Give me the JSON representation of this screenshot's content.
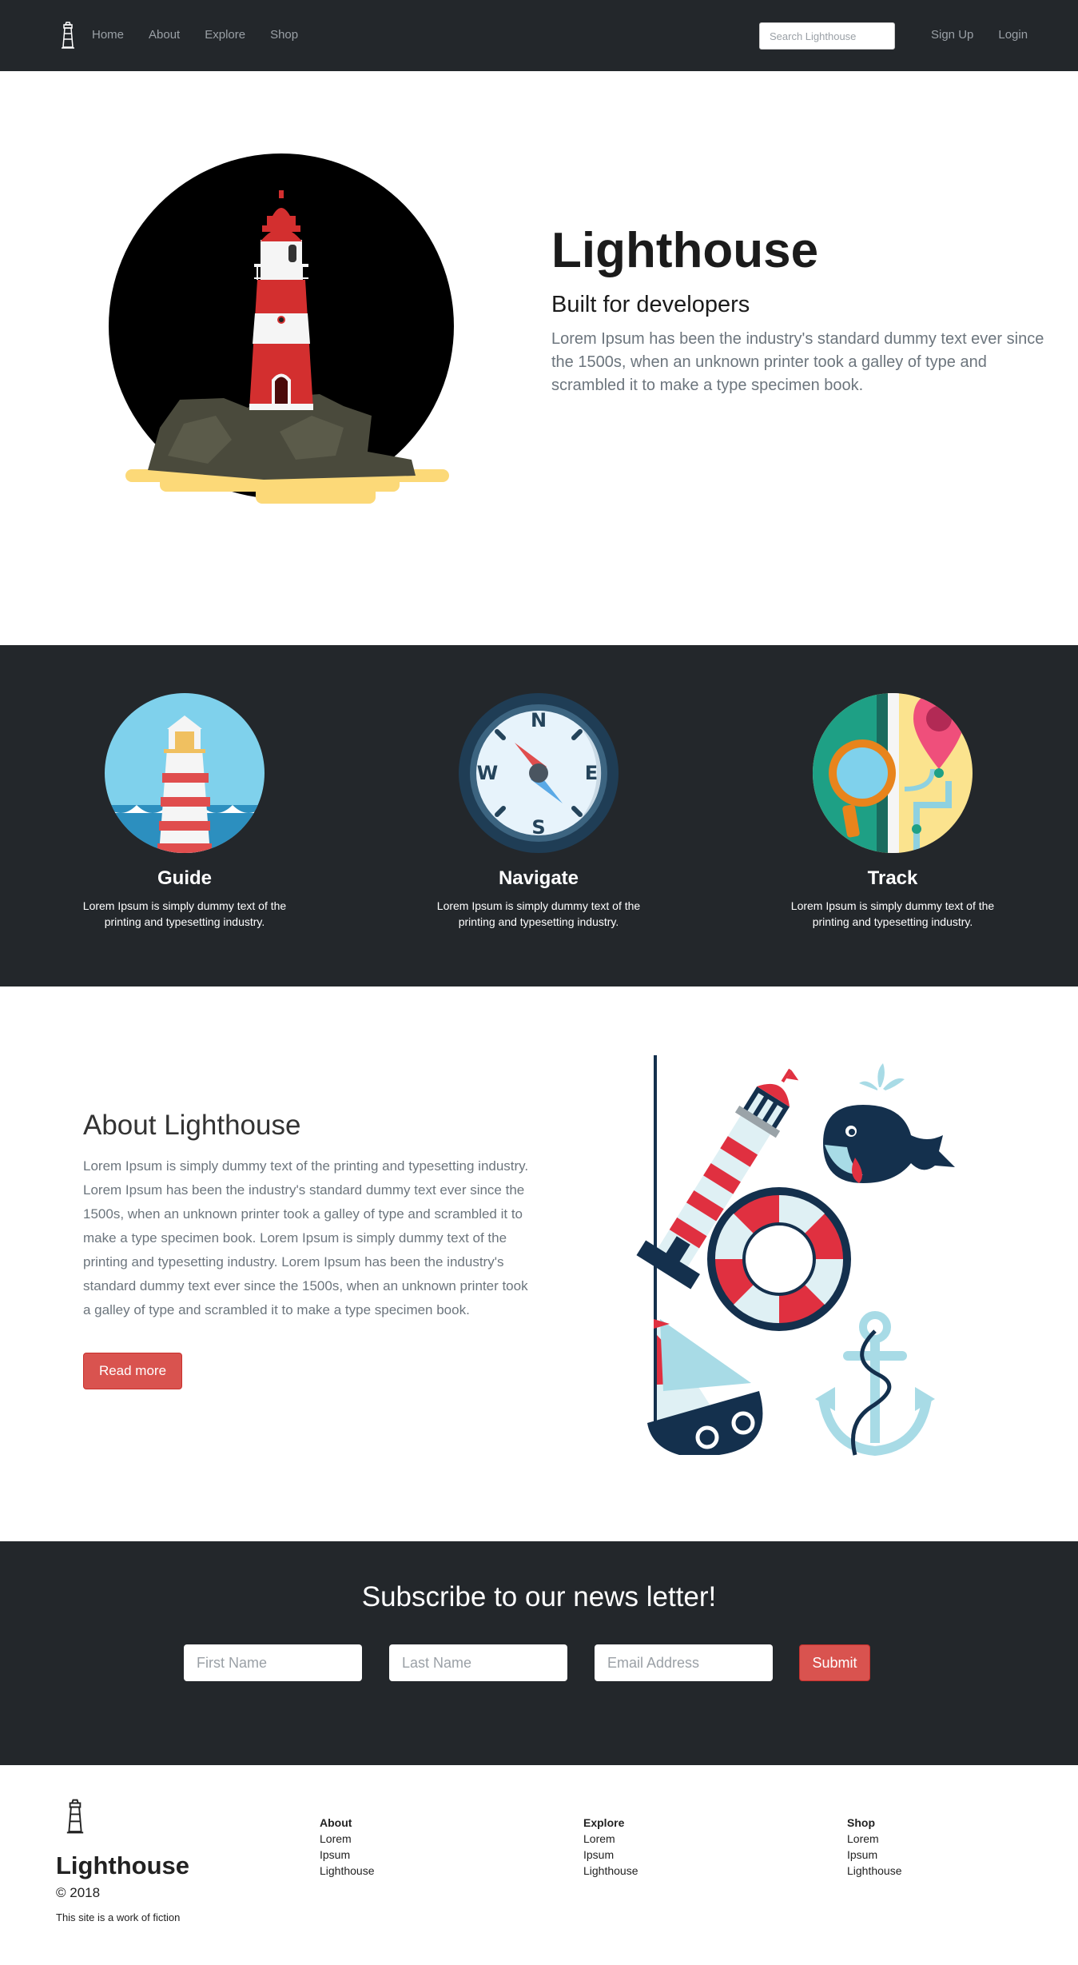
{
  "nav": {
    "links": [
      "Home",
      "About",
      "Explore",
      "Shop"
    ],
    "search_placeholder": "Search Lighthouse",
    "signup": "Sign Up",
    "login": "Login"
  },
  "hero": {
    "title": "Lighthouse",
    "subtitle": "Built for developers",
    "text": "Lorem Ipsum has been the industry's standard dummy text ever since the 1500s, when an unknown printer took a galley of type and scrambled it to make a type specimen book."
  },
  "features": [
    {
      "icon": "lighthouse-icon",
      "title": "Guide",
      "text": "Lorem Ipsum is simply dummy text of the printing and typesetting industry."
    },
    {
      "icon": "compass-icon",
      "title": "Navigate",
      "text": "Lorem Ipsum is simply dummy text of the printing and typesetting industry."
    },
    {
      "icon": "map-icon",
      "title": "Track",
      "text": "Lorem Ipsum is simply dummy text of the printing and typesetting industry."
    }
  ],
  "compass_letters": {
    "n": "N",
    "e": "E",
    "s": "S",
    "w": "W"
  },
  "about": {
    "title": "About Lighthouse",
    "text": "Lorem Ipsum is simply dummy text of the printing and typesetting industry. Lorem Ipsum has been the industry's standard dummy text ever since the 1500s, when an unknown printer took a galley of type and scrambled it to make a type specimen book. Lorem Ipsum is simply dummy text of the printing and typesetting industry. Lorem Ipsum has been the industry's standard dummy text ever since the 1500s, when an unknown printer took a galley of type and scrambled it to make a type specimen book.",
    "button": "Read more"
  },
  "subscribe": {
    "title": "Subscribe to our news letter!",
    "first_name": "First Name",
    "last_name": "Last Name",
    "email": "Email Address",
    "submit": "Submit"
  },
  "footer": {
    "brand": "Lighthouse",
    "year": "© 2018",
    "note": "This site is a work of fiction",
    "columns": [
      {
        "heading": "About",
        "links": [
          "Lorem",
          "Ipsum",
          "Lighthouse"
        ]
      },
      {
        "heading": "Explore",
        "links": [
          "Lorem",
          "Ipsum",
          "Lighthouse"
        ]
      },
      {
        "heading": "Shop",
        "links": [
          "Lorem",
          "Ipsum",
          "Lighthouse"
        ]
      }
    ]
  },
  "colors": {
    "dark": "#23272b",
    "accent": "#d9534f"
  }
}
